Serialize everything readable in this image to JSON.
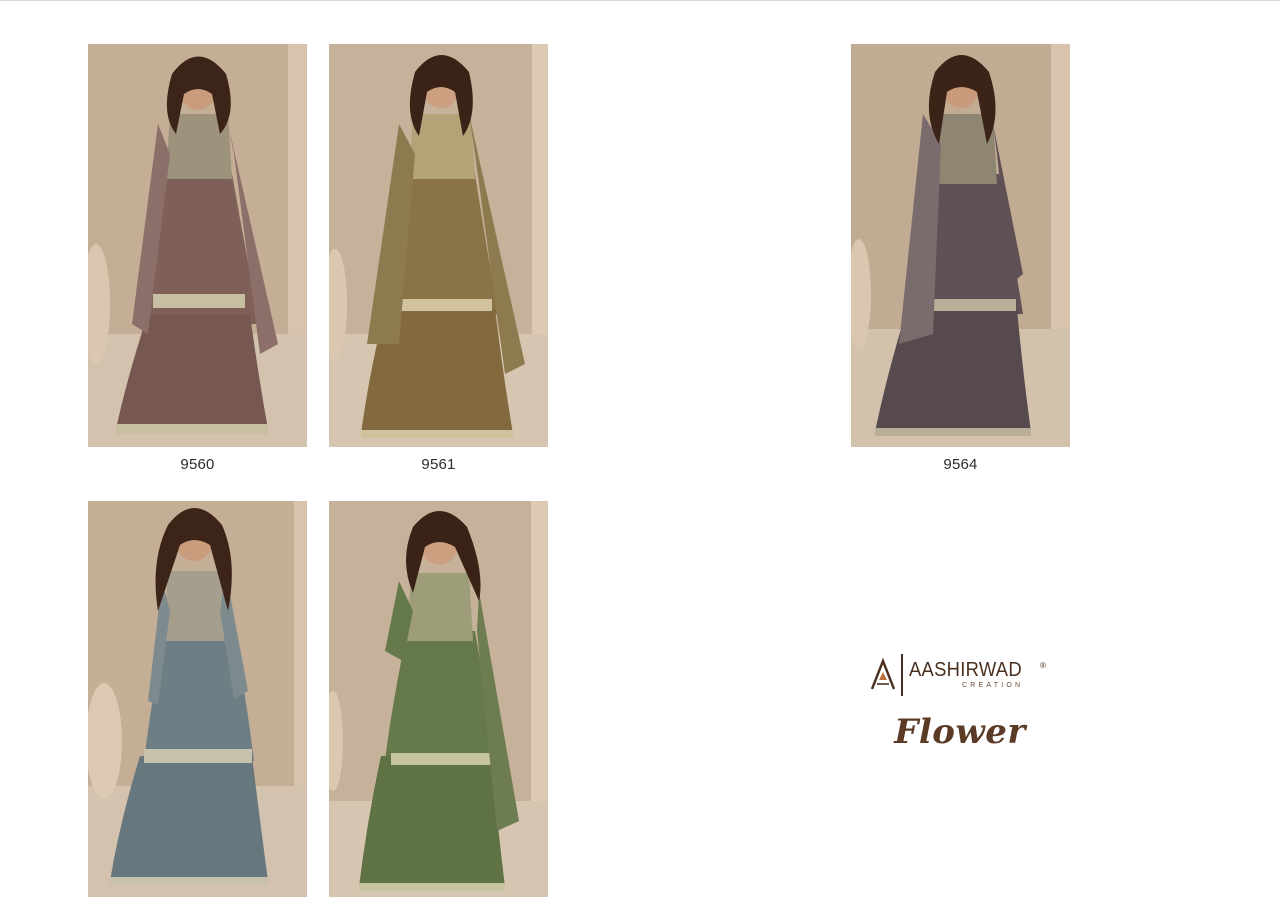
{
  "catalog": {
    "products": [
      {
        "code": "9560",
        "color": "#7e6058",
        "dupatta": "#8c6f68",
        "bodice": "#9d927c"
      },
      {
        "code": "9561",
        "color": "#8a7346",
        "dupatta": "#8d7a4e",
        "bodice": "#b2a476"
      },
      {
        "code": "9564",
        "color": "#5e5055",
        "dupatta": "#7a6c6c",
        "bodice": "#8e8672"
      },
      {
        "code": "",
        "color": "#6d7f85",
        "dupatta": "#7d8b8e",
        "bodice": "#a59e8c"
      },
      {
        "code": "",
        "color": "#66794a",
        "dupatta": "#6e7c52",
        "bodice": "#9e9d7a"
      }
    ]
  },
  "brand": {
    "name": "AASHIRWAD",
    "registered": "®",
    "subtitle": "CREATION",
    "collection": "Flower",
    "icon": "brand-a-logo-icon",
    "color": "#4a2f1f"
  }
}
